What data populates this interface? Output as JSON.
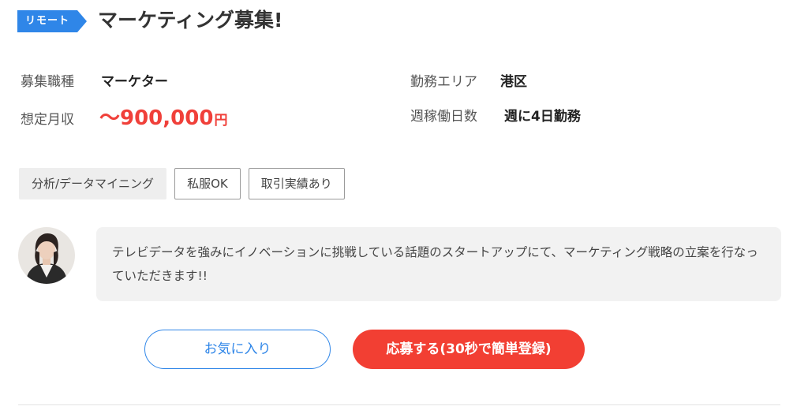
{
  "header": {
    "badge_label": "リモート",
    "title": "マーケティング募集!"
  },
  "info": {
    "job_type_label": "募集職種",
    "job_type_value": "マーケター",
    "area_label": "勤務エリア",
    "area_value": "港区",
    "salary_label": "想定月収",
    "salary_value": "〜900,000",
    "salary_unit": "円",
    "workdays_label": "週稼働日数",
    "workdays_value": "週に4日勤務"
  },
  "tags": [
    {
      "label": "分析/データマイニング"
    },
    {
      "label": "私服OK"
    },
    {
      "label": "取引実績あり"
    }
  ],
  "message": {
    "text": "テレビデータを強みにイノベーションに挑戦している話題のスタートアップにて、マーケティング戦略の立案を行なっていただきます!!"
  },
  "actions": {
    "favorite_label": "お気に入り",
    "apply_label": "応募する(30秒で簡単登録)"
  },
  "colors": {
    "badge": "#2f86e8",
    "salary": "#f0403a",
    "favorite_border": "#2f86e8",
    "apply_bg": "#f23f33"
  },
  "icons": {
    "avatar": "person-avatar"
  }
}
